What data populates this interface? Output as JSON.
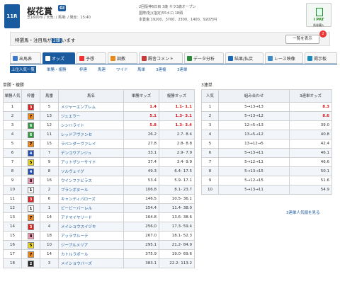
{
  "race": {
    "number": "11R",
    "title": "桜花賞",
    "grade": "GI",
    "conditions": "芝1600m / 天気: / 馬場: / 発走：15:40",
    "details": [
      "2回阪神6日目 3歳 サラ3歳オープン",
      "国際(牝)(指定)55キロ 18頭",
      "本賞金:19200、3700、2300、1400、920万円"
    ]
  },
  "ipat": {
    "title": "I PAT",
    "label": "馬券購入"
  },
  "notice": {
    "prefix": "特選馬・注目馬が",
    "count": "2頭",
    "suffix": "います",
    "button": "一覧を表示",
    "badge": "2"
  },
  "tabs": [
    "出馬表",
    "オッズ",
    "予想",
    "調教",
    "厩舎コメント",
    "データ分析",
    "結果/払戻",
    "レース映像",
    "掲示板"
  ],
  "tab_colors": [
    "#3a7ac8",
    "#ffffff",
    "#e33",
    "#e88a1a",
    "#c83a3a",
    "#2a8a3a",
    "#1a6ab8",
    "#3a8ac8",
    "#1a8ab8"
  ],
  "subtabs": [
    "上位人気一覧",
    "単勝・複勝",
    "枠連",
    "馬連",
    "ワイド",
    "馬単",
    "3連複",
    "3連単"
  ],
  "win_place": {
    "title": "単勝・複勝",
    "headers": [
      "単勝人気",
      "枠番",
      "馬番",
      "馬名",
      "単勝オッズ",
      "複勝オッズ"
    ],
    "rows": [
      {
        "rank": "1",
        "waku": "3",
        "uma": "5",
        "name": "メジャーエンブレム",
        "win": "1.4",
        "place": "1.1- 1.1"
      },
      {
        "rank": "2",
        "waku": "7",
        "uma": "13",
        "name": "ジュエラー",
        "win": "5.1",
        "place": "1.3- 3.1"
      },
      {
        "rank": "3",
        "waku": "6",
        "uma": "12",
        "name": "シンハライト",
        "win": "5.8",
        "place": "1.3- 3.4"
      },
      {
        "rank": "4",
        "waku": "6",
        "uma": "11",
        "name": "レッドアヴァンセ",
        "win": "26.2",
        "place": "2.7- 8.4"
      },
      {
        "rank": "5",
        "waku": "7",
        "uma": "15",
        "name": "ラベンダーヴァレイ",
        "win": "27.8",
        "place": "2.8- 8.8"
      },
      {
        "rank": "6",
        "waku": "4",
        "uma": "7",
        "name": "デンコウアンジュ",
        "win": "33.1",
        "place": "2.9- 7.9"
      },
      {
        "rank": "7",
        "waku": "5",
        "uma": "9",
        "name": "アットザシーサイド",
        "win": "37.4",
        "place": "3.4- 9.9"
      },
      {
        "rank": "8",
        "waku": "4",
        "uma": "8",
        "name": "ソルヴェイグ",
        "win": "49.3",
        "place": "6.4- 17.5"
      },
      {
        "rank": "9",
        "waku": "8",
        "uma": "16",
        "name": "ウインファビラス",
        "win": "53.4",
        "place": "5.9- 17.1"
      },
      {
        "rank": "10",
        "waku": "1",
        "uma": "2",
        "name": "ブランボヌール",
        "win": "106.8",
        "place": "8.1- 23.7"
      },
      {
        "rank": "11",
        "waku": "3",
        "uma": "6",
        "name": "キャンディバローズ",
        "win": "146.5",
        "place": "10.5- 36.1"
      },
      {
        "rank": "12",
        "waku": "1",
        "uma": "1",
        "name": "ビービーバーレル",
        "win": "154.4",
        "place": "11.4- 38.0"
      },
      {
        "rank": "13",
        "waku": "7",
        "uma": "14",
        "name": "アドマイヤリード",
        "win": "164.8",
        "place": "13.6- 38.6"
      },
      {
        "rank": "14",
        "waku": "3",
        "uma": "4",
        "name": "メイショウスイヅキ",
        "win": "256.0",
        "place": "17.3- 59.4"
      },
      {
        "rank": "15",
        "waku": "8",
        "uma": "18",
        "name": "アッラサルーテ",
        "win": "267.0",
        "place": "18.1- 52.3"
      },
      {
        "rank": "16",
        "waku": "5",
        "uma": "10",
        "name": "ジープルメリア",
        "win": "295.1",
        "place": "21.2- 84.9"
      },
      {
        "rank": "17",
        "waku": "7",
        "uma": "14",
        "name": "カトルラポール",
        "win": "375.9",
        "place": "19.0- 69.6"
      },
      {
        "rank": "18",
        "waku": "2",
        "uma": "3",
        "name": "メイショウバーズ",
        "win": "383.1",
        "place": "22.2- 113.2"
      }
    ]
  },
  "trifecta": {
    "title": "3連単",
    "headers": [
      "人気",
      "組み合わせ",
      "3連単オッズ"
    ],
    "rows": [
      {
        "rank": "1",
        "combo": "5→13→13",
        "odds": "8.3"
      },
      {
        "rank": "2",
        "combo": "5→13→12",
        "odds": "8.6"
      },
      {
        "rank": "3",
        "combo": "12→5→13",
        "odds": "39.0"
      },
      {
        "rank": "4",
        "combo": "13→5→12",
        "odds": "40.8"
      },
      {
        "rank": "5",
        "combo": "13→12→5",
        "odds": "42.4"
      },
      {
        "rank": "6",
        "combo": "5→13→11",
        "odds": "46.1"
      },
      {
        "rank": "7",
        "combo": "5→12→11",
        "odds": "46.6"
      },
      {
        "rank": "8",
        "combo": "5→13→15",
        "odds": "50.1"
      },
      {
        "rank": "9",
        "combo": "5→12→15",
        "odds": "51.6"
      },
      {
        "rank": "10",
        "combo": "5→13→11",
        "odds": "54.9"
      }
    ],
    "more_link": "3連単人気順を見る"
  },
  "waku_colors": {
    "1": {
      "bg": "#ffffff",
      "fg": "#000000"
    },
    "2": {
      "bg": "#222222",
      "fg": "#ffffff"
    },
    "3": {
      "bg": "#e02020",
      "fg": "#ffffff"
    },
    "4": {
      "bg": "#1a4ab8",
      "fg": "#ffffff"
    },
    "5": {
      "bg": "#f0d820",
      "fg": "#000000"
    },
    "6": {
      "bg": "#2a9a3a",
      "fg": "#ffffff"
    },
    "7": {
      "bg": "#f08a1a",
      "fg": "#000000"
    },
    "8": {
      "bg": "#f5a0b8",
      "fg": "#000000"
    }
  }
}
